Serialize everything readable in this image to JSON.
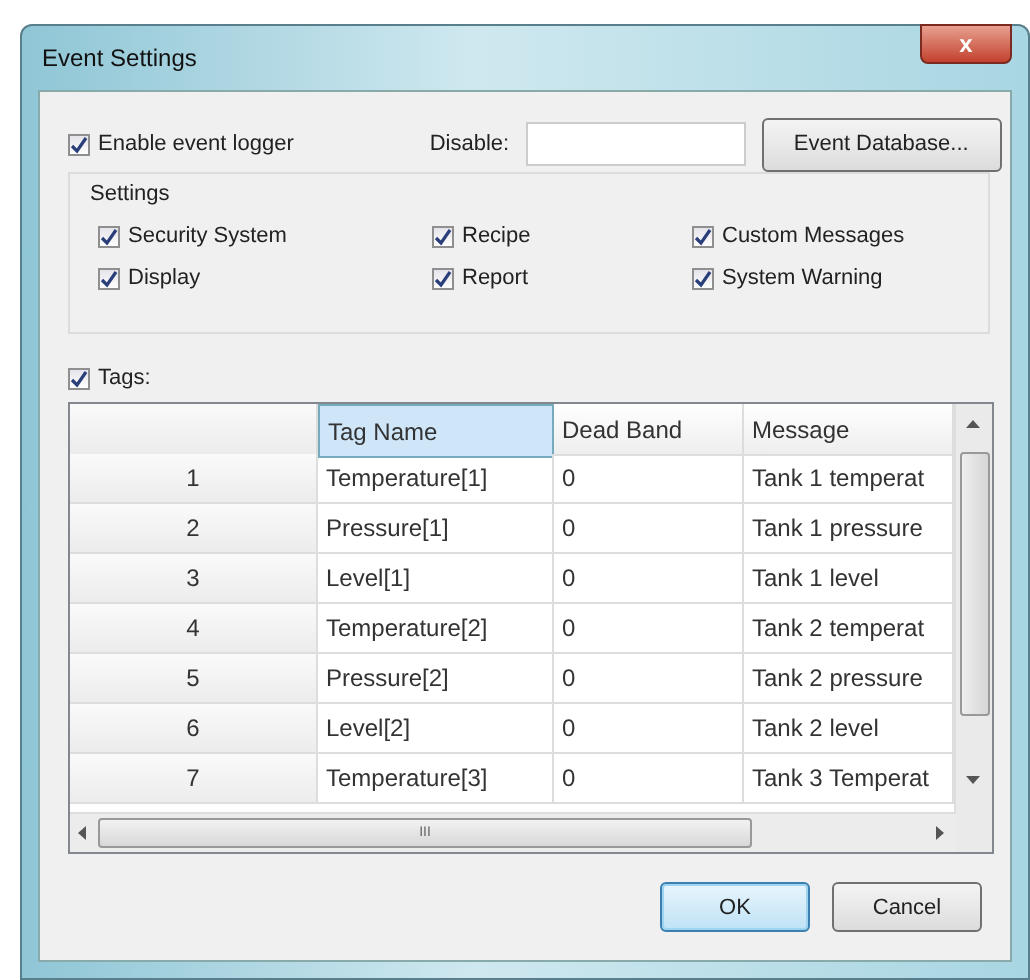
{
  "window": {
    "title": "Event Settings",
    "close": "x"
  },
  "logger": {
    "label": "Enable event logger",
    "checked": true
  },
  "disable": {
    "label": "Disable:"
  },
  "database_button": "Event Database...",
  "settings": {
    "title": "Settings",
    "options": [
      {
        "label": "Security System",
        "checked": true
      },
      {
        "label": "Recipe",
        "checked": true
      },
      {
        "label": "Custom Messages",
        "checked": true
      },
      {
        "label": "Display",
        "checked": true
      },
      {
        "label": "Report",
        "checked": true
      },
      {
        "label": "System Warning",
        "checked": true
      }
    ]
  },
  "tags": {
    "label": "Tags:",
    "checked": true
  },
  "table": {
    "columns": [
      {
        "label": "Tag Name",
        "selected": true
      },
      {
        "label": "Dead Band",
        "selected": false
      },
      {
        "label": "Message",
        "selected": false
      }
    ],
    "rows": [
      {
        "index": "1",
        "cells": [
          "Temperature[1]",
          "0",
          "Tank 1 temperat"
        ]
      },
      {
        "index": "2",
        "cells": [
          "Pressure[1]",
          "0",
          "Tank 1 pressure"
        ]
      },
      {
        "index": "3",
        "cells": [
          "Level[1]",
          "0",
          "Tank 1 level"
        ]
      },
      {
        "index": "4",
        "cells": [
          "Temperature[2]",
          "0",
          "Tank 2 temperat"
        ]
      },
      {
        "index": "5",
        "cells": [
          "Pressure[2]",
          "0",
          "Tank 2 pressure"
        ]
      },
      {
        "index": "6",
        "cells": [
          "Level[2]",
          "0",
          "Tank 2 level"
        ]
      },
      {
        "index": "7",
        "cells": [
          "Temperature[3]",
          "0",
          "Tank 3 Temperat"
        ]
      }
    ],
    "hscroll_grip": "III"
  },
  "buttons": [
    {
      "label": "OK",
      "default": true
    },
    {
      "label": "Cancel",
      "default": false
    }
  ]
}
